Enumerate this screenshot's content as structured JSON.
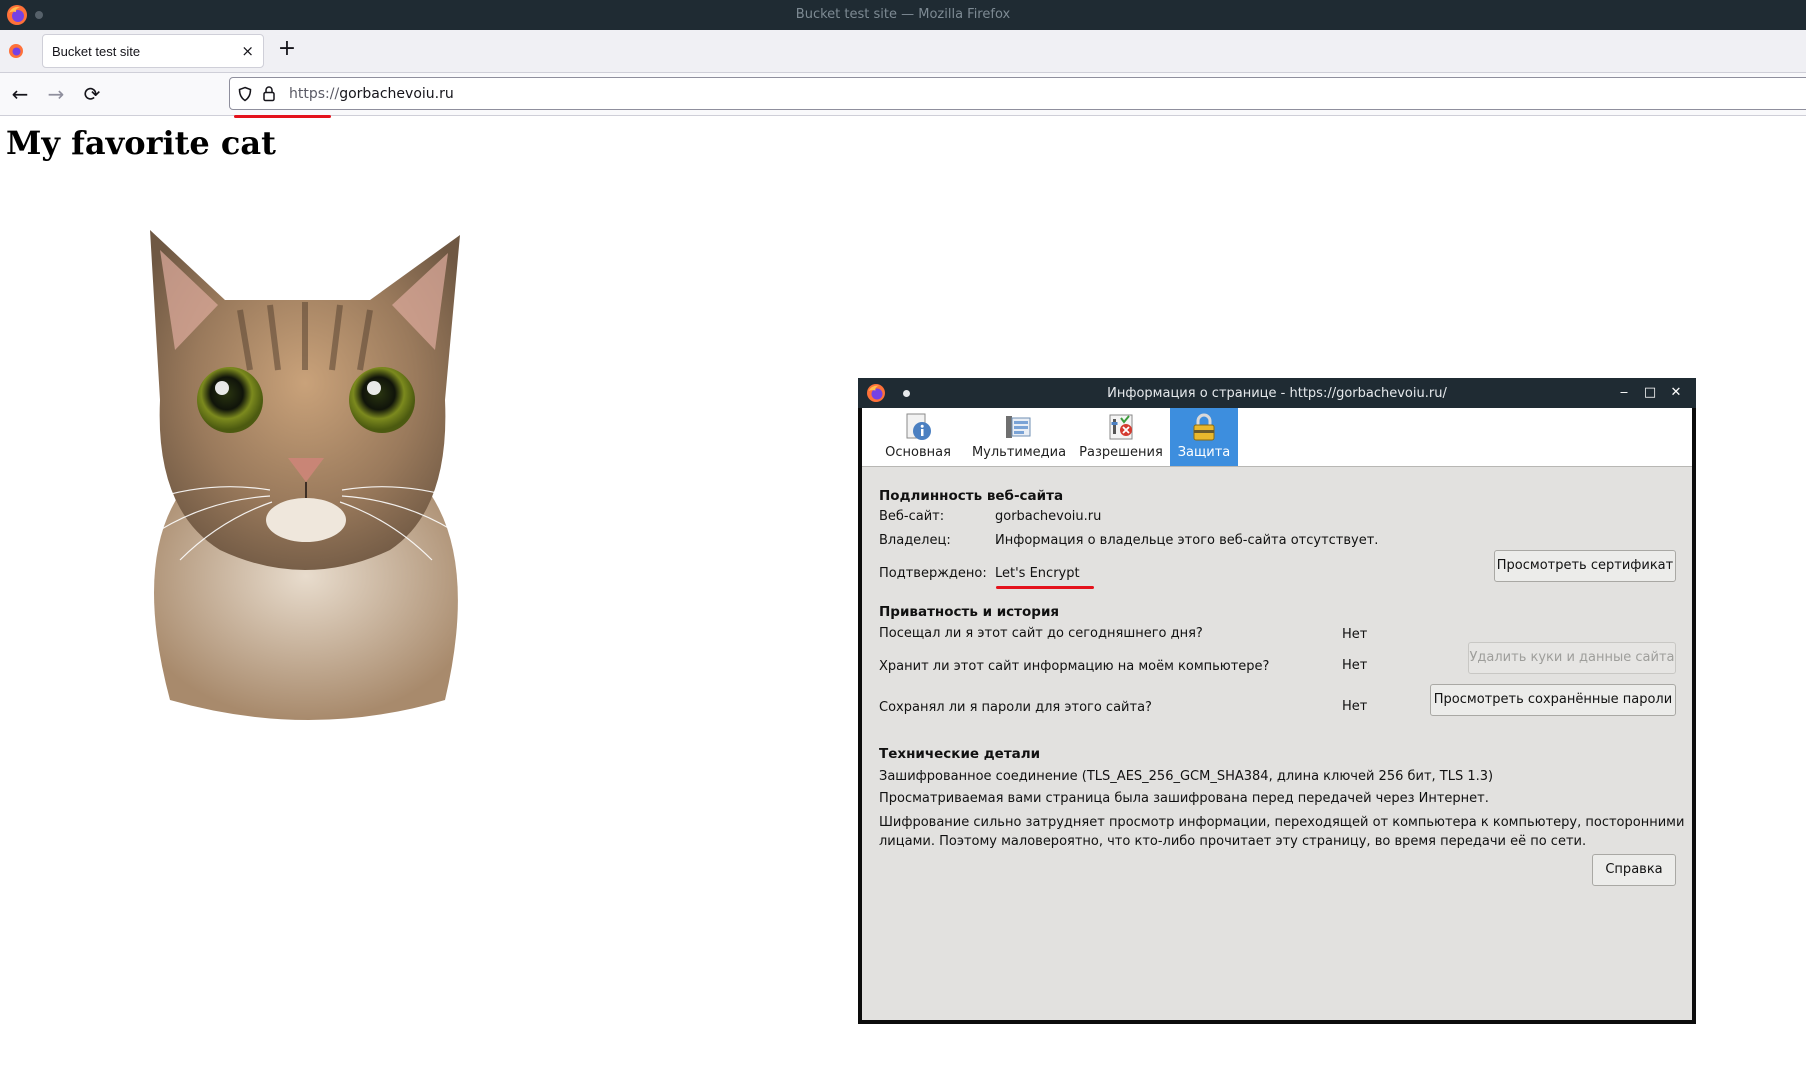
{
  "window": {
    "title": "Bucket test site — Mozilla Firefox"
  },
  "tabs": [
    {
      "label": "Bucket test site",
      "close": "×"
    }
  ],
  "new_tab_label": "+",
  "nav": {
    "back": "←",
    "forward": "→",
    "reload": "⟳"
  },
  "url": {
    "scheme": "https://",
    "host": "gorbachevoiu.ru"
  },
  "page": {
    "heading": "My favorite cat"
  },
  "dialog": {
    "title": "Информация о странице - https://gorbachevoiu.ru/",
    "window_buttons": {
      "minimize": "‒",
      "maximize": "□",
      "close": "✕"
    },
    "tabs": [
      {
        "label": "Основная",
        "icon": "info-page-icon"
      },
      {
        "label": "Мультимедиа",
        "icon": "media-icon"
      },
      {
        "label": "Разрешения",
        "icon": "permissions-icon"
      },
      {
        "label": "Защита",
        "icon": "lock-icon",
        "active": true
      }
    ],
    "identity": {
      "heading": "Подлинность веб-сайта",
      "website_label": "Веб-сайт:",
      "website_value": "gorbachevoiu.ru",
      "owner_label": "Владелец:",
      "owner_value": "Информация о владельце этого веб-сайта отсутствует.",
      "verified_label": "Подтверждено:",
      "verified_value": "Let's Encrypt",
      "view_cert_button": "Просмотреть сертификат"
    },
    "privacy": {
      "heading": "Приватность и история",
      "visited_q": "Посещал ли я этот сайт до сегодняшнего дня?",
      "visited_a": "Нет",
      "stores_q": "Хранит ли этот сайт информацию на моём компьютере?",
      "stores_a": "Нет",
      "clear_button": "Удалить куки и данные сайта",
      "passwords_q": "Сохранял ли я пароли для этого сайта?",
      "passwords_a": "Нет",
      "view_passwords_button": "Просмотреть сохранённые пароли"
    },
    "technical": {
      "heading": "Технические детали",
      "line1": "Зашифрованное соединение (TLS_AES_256_GCM_SHA384, длина ключей 256 бит, TLS 1.3)",
      "line2": "Просматриваемая вами страница была зашифрована перед передачей через Интернет.",
      "line3a": "Шифрование сильно затрудняет просмотр информации, переходящей от компьютера к компьютеру, посторонними",
      "line3b": "лицами. Поэтому маловероятно, что кто-либо прочитает эту страницу, во время передачи её по сети.",
      "help_button": "Справка"
    }
  },
  "colors": {
    "accent": "#3d8ede",
    "annotation_underline": "#e4121c",
    "titlebar": "#1f2b33"
  }
}
